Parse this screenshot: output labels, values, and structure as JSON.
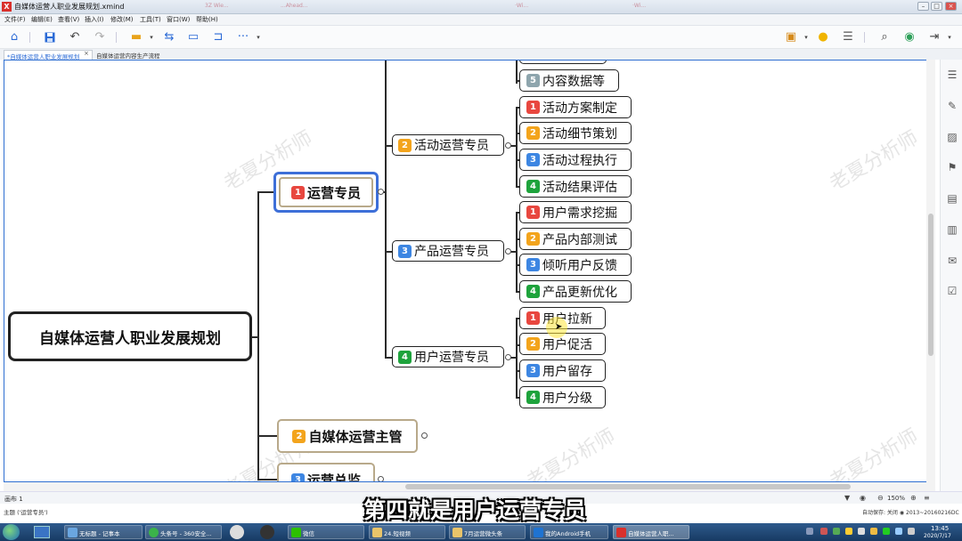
{
  "window": {
    "title": "自媒体运营人职业发展规划.xmind",
    "ghost_tabs": [
      "3Z Wie...",
      "...Ahead...",
      "·Wi...",
      "·Wi..."
    ],
    "controls": [
      "–",
      "□",
      "×"
    ]
  },
  "menu": [
    "文件(F)",
    "编辑(E)",
    "查看(V)",
    "插入(I)",
    "修改(M)",
    "工具(T)",
    "窗口(W)",
    "帮助(H)"
  ],
  "tabs": {
    "active": "*自媒体运营人职业发展规划",
    "inactive": "自媒体运营内容生产流程",
    "close": "×"
  },
  "mindmap": {
    "root": "自媒体运营人职业发展规划",
    "main_topics": [
      {
        "num": "1",
        "label": "运营专员"
      },
      {
        "num": "2",
        "label": "自媒体运营主管"
      },
      {
        "num": "3",
        "label": "运营总监"
      }
    ],
    "sub_topics": [
      {
        "num": "2",
        "label": "活动运营专员"
      },
      {
        "num": "3",
        "label": "产品运营专员"
      },
      {
        "num": "4",
        "label": "用户运营专员"
      }
    ],
    "leaves": [
      {
        "num": "5",
        "label": "内容数据等"
      },
      {
        "num": "1",
        "label": "活动方案制定"
      },
      {
        "num": "2",
        "label": "活动细节策划"
      },
      {
        "num": "3",
        "label": "活动过程执行"
      },
      {
        "num": "4",
        "label": "活动结果评估"
      },
      {
        "num": "1",
        "label": "用户需求挖掘"
      },
      {
        "num": "2",
        "label": "产品内部测试"
      },
      {
        "num": "3",
        "label": "倾听用户反馈"
      },
      {
        "num": "4",
        "label": "产品更新优化"
      },
      {
        "num": "1",
        "label": "用户拉新"
      },
      {
        "num": "2",
        "label": "用户促活"
      },
      {
        "num": "3",
        "label": "用户留存"
      },
      {
        "num": "4",
        "label": "用户分级"
      }
    ],
    "watermark": "老夏分析师"
  },
  "status": {
    "sheet": "画布 1",
    "zoom": "150%",
    "topic": "主题 ('运营专员')",
    "autosave": "自动保存: 关闭",
    "version": "2013~20160216DC"
  },
  "subtitle": "第四就是用户运营专员",
  "taskbar": {
    "items": [
      "无标题 - 记事本",
      "头条号 - 360安全...",
      "微信",
      "24.短视频",
      "7月运营微头条",
      "我的Android手机",
      "自媒体运营人职..."
    ],
    "time": "13:45",
    "date": "2020/7/17"
  }
}
